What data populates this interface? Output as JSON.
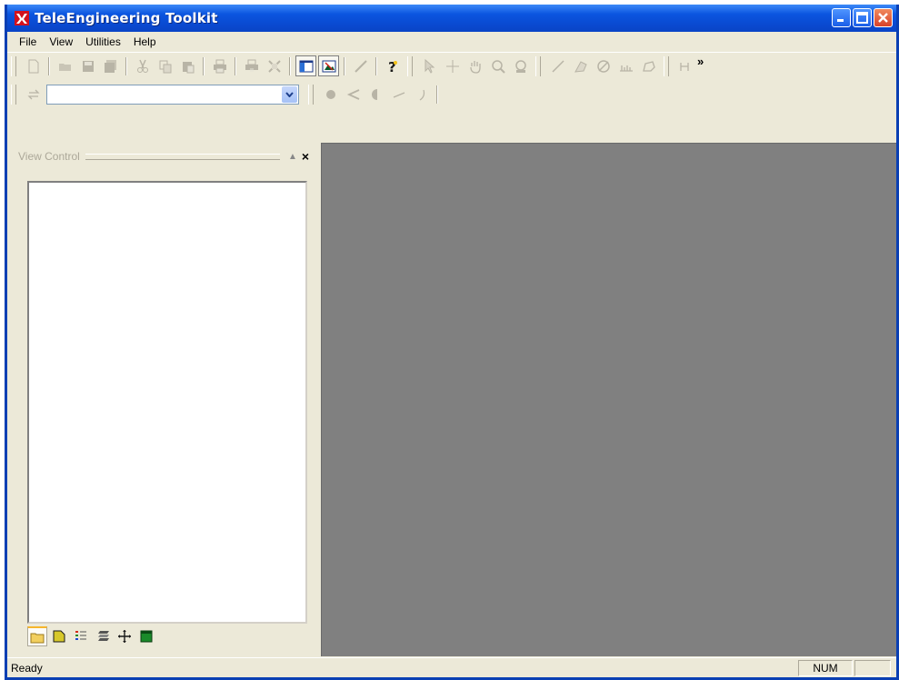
{
  "window": {
    "title": "TeleEngineering Toolkit"
  },
  "menu": [
    {
      "label": "File"
    },
    {
      "label": "View"
    },
    {
      "label": "Utilities"
    },
    {
      "label": "Help"
    }
  ],
  "toolbar": {
    "overflow_label": "»",
    "combo_value": ""
  },
  "panel": {
    "title": "View Control",
    "close_label": "×",
    "pin_label": "▲"
  },
  "status": {
    "text": "Ready",
    "num": "NUM"
  },
  "colors": {
    "titlebar": "#0a49d0",
    "client_bg": "#808080",
    "chrome": "#ece9d8",
    "active_tab": "#f7b62c"
  }
}
